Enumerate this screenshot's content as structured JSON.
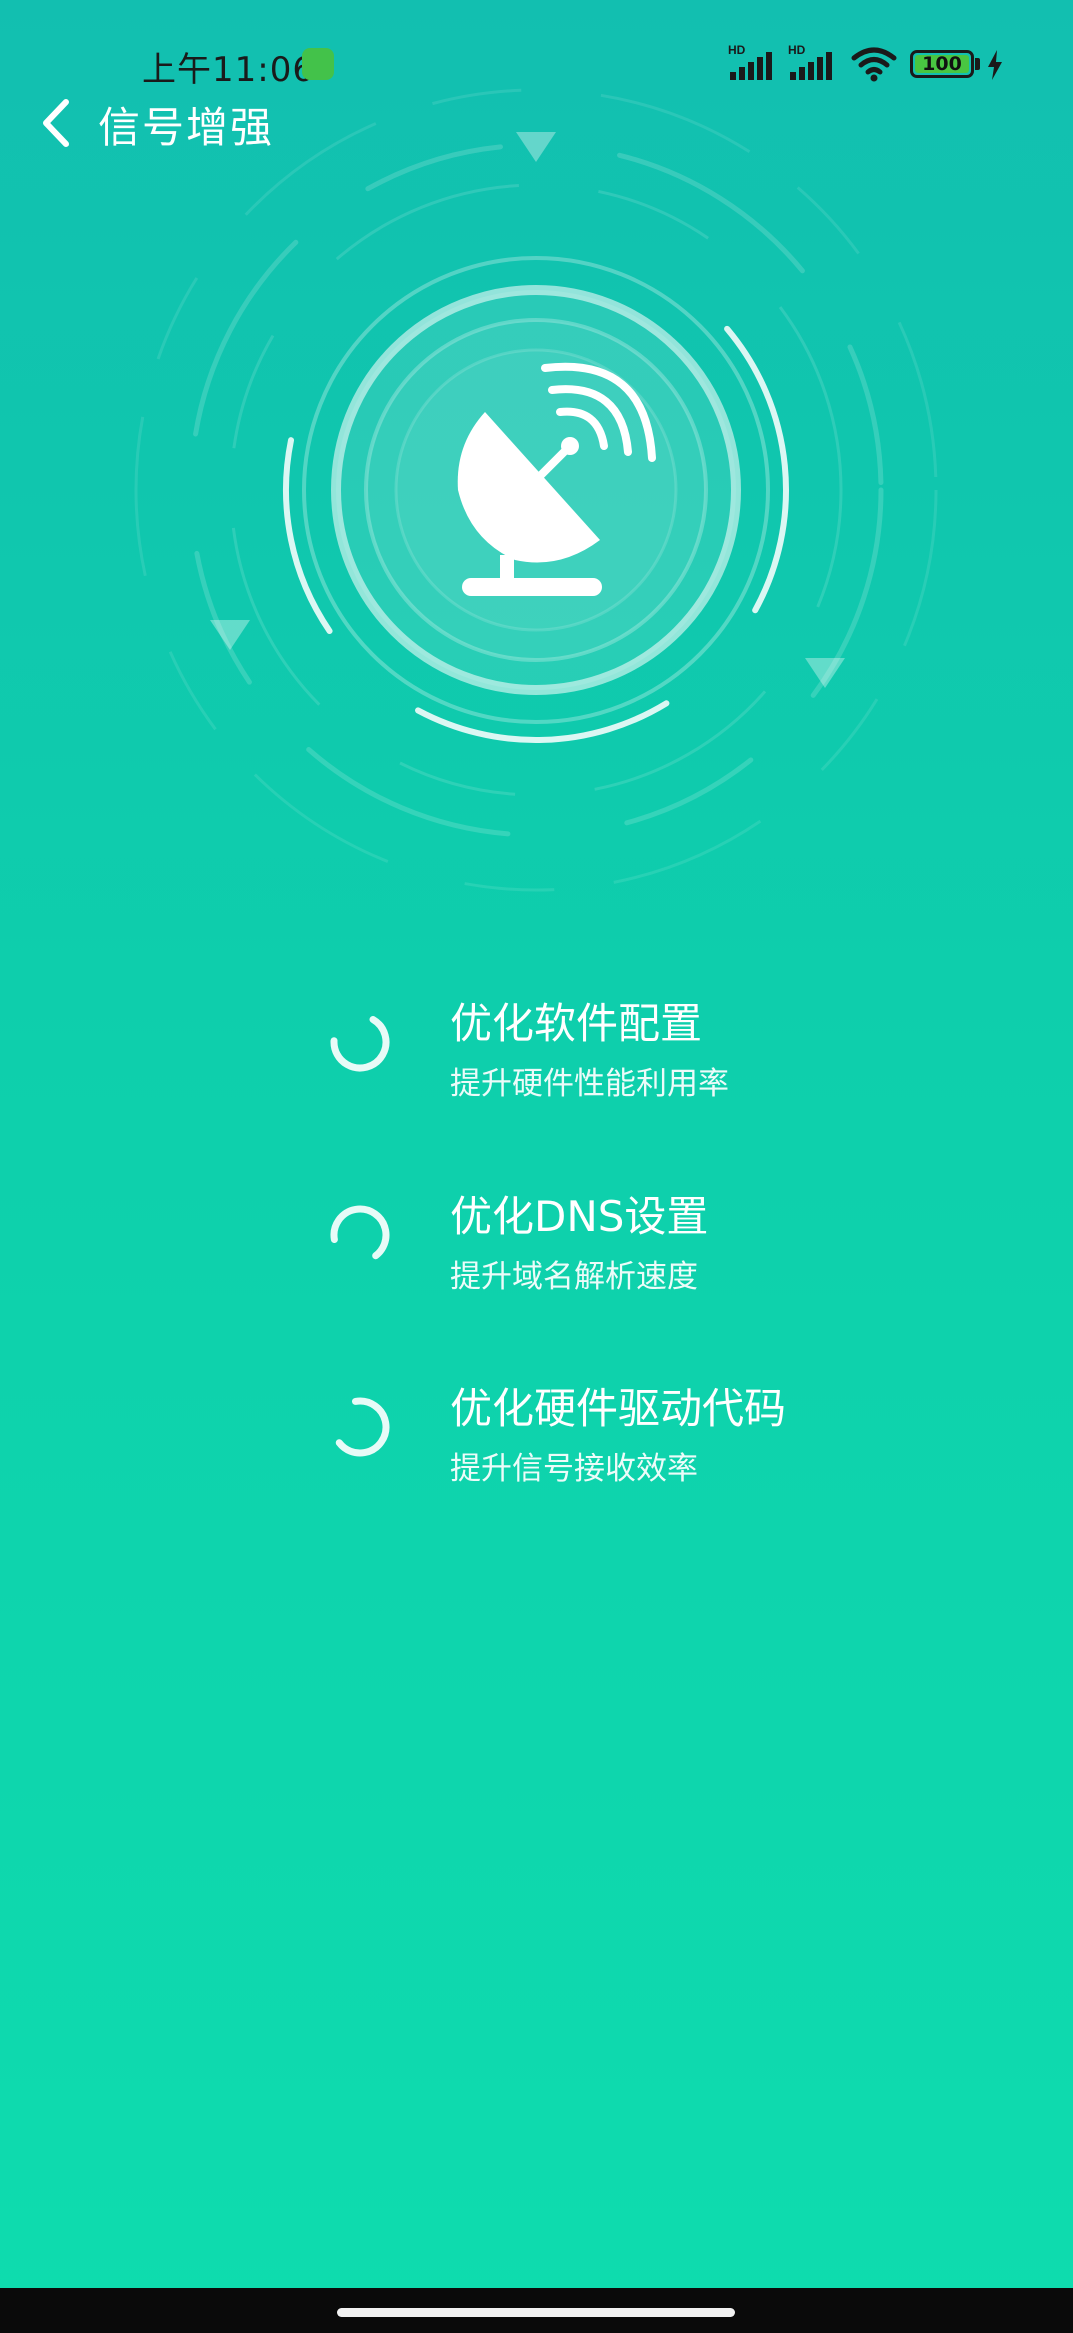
{
  "status_bar": {
    "time": "上午11:06",
    "battery_level": "100",
    "icons": [
      "app-notification-icon",
      "signal-hd-icon",
      "signal-hd-icon",
      "wifi-icon",
      "battery-icon",
      "charging-bolt-icon"
    ],
    "signal_label": "HD"
  },
  "header": {
    "back_icon": "chevron-left-icon",
    "title": "信号增强"
  },
  "hero": {
    "icon": "satellite-dish-icon"
  },
  "tasks": [
    {
      "title": "优化软件配置",
      "subtitle": "提升硬件性能利用率",
      "status_icon": "loading-spinner-icon"
    },
    {
      "title": "优化DNS设置",
      "subtitle": "提升域名解析速度",
      "status_icon": "loading-spinner-icon"
    },
    {
      "title": "优化硬件驱动代码",
      "subtitle": "提升信号接收效率",
      "status_icon": "loading-spinner-icon"
    }
  ],
  "colors": {
    "gradient_top": "#12bfb0",
    "gradient_bottom": "#0edcae",
    "text": "#ffffff",
    "battery_fill": "#49c642"
  }
}
